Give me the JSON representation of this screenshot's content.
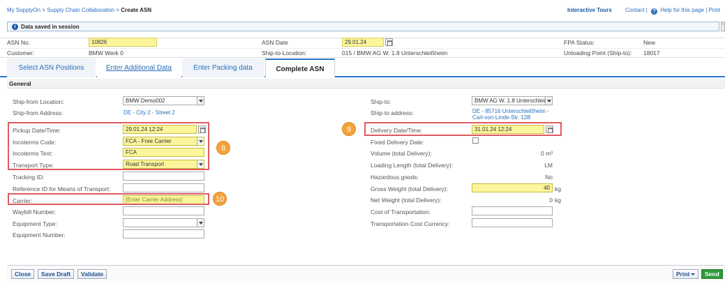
{
  "breadcrumb": {
    "item1": "My SupplyOn",
    "sep": ">",
    "item2": "Supply Chain Collaboration",
    "current": "Create ASN"
  },
  "toplinks": {
    "tours": "Interactive Tours",
    "contact": "Contact |",
    "help": "Help for this page",
    "print": "| Print"
  },
  "message": {
    "text": "Data saved in session",
    "scroll_glyph": "↕"
  },
  "header": {
    "asn_no_label": "ASN No.",
    "asn_no_value": "10826",
    "asn_date_label": "ASN Date",
    "asn_date_value": "29.01.24",
    "fpa_label": "FPA Status:",
    "fpa_value": "New",
    "customer_label": "Customer:",
    "customer_value": "BMW Werk 0",
    "shipto_loc_label": "Ship-to-Location:",
    "shipto_loc_value": "015 / BMW AG W. 1.8 Unterschleißheim",
    "unloading_label": "Unloading Point (Ship-to):",
    "unloading_value": "18017"
  },
  "tabs": [
    {
      "label": "Select ASN Positions"
    },
    {
      "label": "Enter Additional Data"
    },
    {
      "label": "Enter Packing data"
    },
    {
      "label": "Complete ASN"
    }
  ],
  "section_title": "General",
  "left": {
    "ship_from_location_label": "Ship-from Location:",
    "ship_from_location_value": "BMW Demo002",
    "ship_from_address_label": "Ship-from Address:",
    "ship_from_address_value": "DE - City 2 - Street 2",
    "pickup_label": "Pickup Date/Time:",
    "pickup_value": "29.01.24 12:24",
    "incoterms_code_label": "Incoterms Code:",
    "incoterms_code_value": "FCA - Free Carrier",
    "incoterms_text_label": "Incoterms Text:",
    "incoterms_text_value": "FCA",
    "transport_type_label": "Transport Type:",
    "transport_type_value": "Road Transport",
    "tracking_label": "Tracking ID:",
    "refid_label": "Reference ID for Means of Transport:",
    "carrier_label": "Carrier:",
    "carrier_value": "[Enter Carrier Address]",
    "waybill_label": "Waybill Number:",
    "equipment_type_label": "Equipment Type:",
    "equipment_number_label": "Equipment Number:"
  },
  "right": {
    "ship_to_label": "Ship-to:",
    "ship_to_value": "BMW AG W. 1.8 Unterschleiß",
    "ship_to_address_label": "Ship-to address:",
    "ship_to_address_line1": "DE - 85716 Unterschleißheim -",
    "ship_to_address_line2": "Carl-von-Linde-Str. 12B",
    "delivery_label": "Delivery Date/Time:",
    "delivery_value": "31.01.24 12:24",
    "fixed_delivery_label": "Fixed Delivery Date:",
    "volume_label": "Volume (total Delivery):",
    "volume_value": "0 m³",
    "loading_label": "Loading Length (total Delivery):",
    "loading_value": "LM",
    "hazardous_label": "Hazardous goods:",
    "hazardous_value": "No",
    "gross_label": "Gross Weight (total Delivery):",
    "gross_value": "40",
    "gross_unit": "kg",
    "net_label": "Net Weight (total Delivery):",
    "net_value": "0",
    "net_unit": "kg",
    "cost_label": "Cost of Transportation:",
    "currency_label": "Transportation Cost Currency:"
  },
  "annotations": {
    "badge8": "8",
    "badge9": "9",
    "badge10": "10",
    "highlight_color": "#e05a5f",
    "badge_color": "#f3a23c"
  },
  "footer": {
    "close": "Close",
    "save_draft": "Save Draft",
    "validate": "Validate",
    "print": "Print",
    "send": "Send"
  }
}
